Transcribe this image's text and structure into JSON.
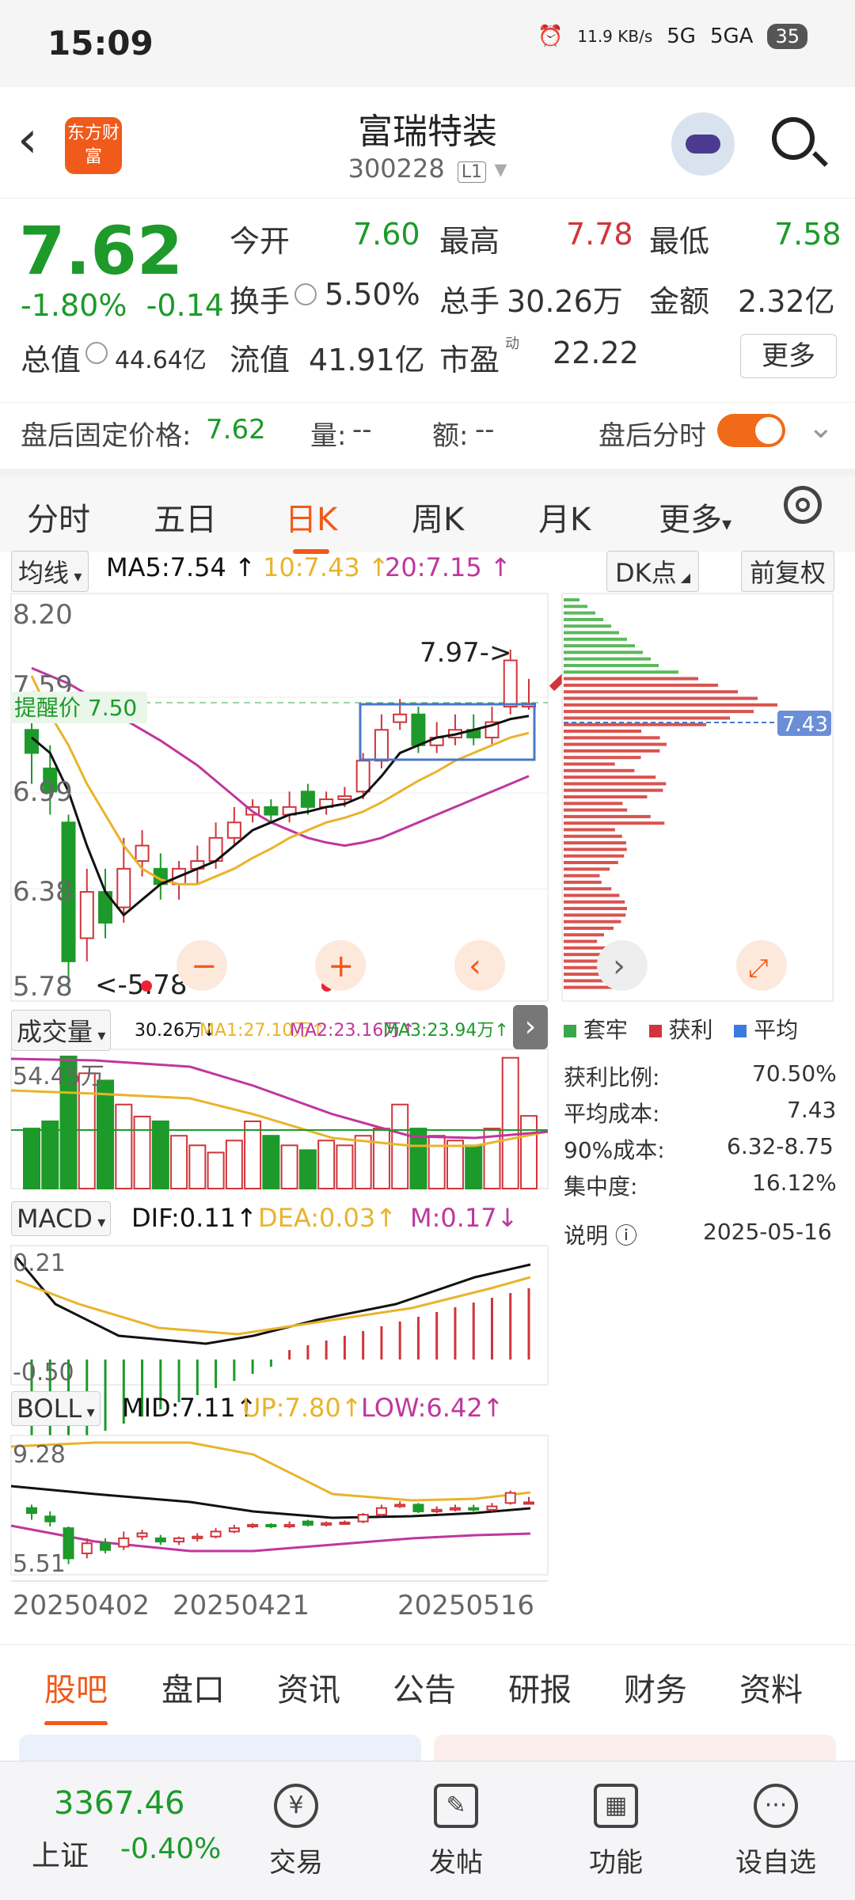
{
  "status_bar": {
    "time": "15:09",
    "net_speed": "11.9 KB/s",
    "signal1": "5G",
    "signal2": "5GA",
    "battery": "35"
  },
  "header": {
    "back_icon": "chevron-left-icon",
    "logo_text": "东方财富",
    "stock_name": "富瑞特装",
    "stock_code": "300228",
    "level": "L1"
  },
  "quote": {
    "price": "7.62",
    "change_pct": "-1.80%",
    "change": "-0.14",
    "open_label": "今开",
    "open": "7.60",
    "high_label": "最高",
    "high": "7.78",
    "low_label": "最低",
    "low": "7.58",
    "turnover_label": "换手",
    "turnover": "5.50%",
    "volume_label": "总手",
    "volume": "30.26万",
    "amount_label": "金额",
    "amount": "2.32亿",
    "mcap_label": "总值",
    "mcap": "44.64亿",
    "float_label": "流值",
    "float": "41.91亿",
    "pe_label": "市盈",
    "pe_sup": "动",
    "pe": "22.22",
    "more_label": "更多"
  },
  "after_hours": {
    "label": "盘后固定价格:",
    "price": "7.62",
    "vol_label": "量:",
    "vol": "--",
    "amt_label": "额:",
    "amt": "--",
    "timeshare_label": "盘后分时"
  },
  "kline_tabs": [
    "分时",
    "五日",
    "日K",
    "周K",
    "月K",
    "更多"
  ],
  "active_tab": "日K",
  "ma_row": {
    "selector": "均线",
    "ma5": "MA5:7.54",
    "ma10": "10:7.43",
    "ma20": "20:7.15",
    "dk_label": "DK点",
    "adjust_label": "前复权"
  },
  "main_chart": {
    "y_max": "8.20",
    "y_2": "7.59",
    "y_3": "6.99",
    "y_4": "6.38",
    "y_min": "5.78",
    "alert_label": "提醒价 7.50",
    "high_annot": "7.97->",
    "low_annot": "<-5.78"
  },
  "chip_chart": {
    "avg_price": "7.43",
    "legend_trapped": "套牢",
    "legend_profit": "获利",
    "legend_avg": "平均",
    "profit_ratio_label": "获利比例:",
    "profit_ratio": "70.50%",
    "avg_cost_label": "平均成本:",
    "avg_cost": "7.43",
    "cost90_label": "90%成本:",
    "cost90": "6.32-8.75",
    "concentration_label": "集中度:",
    "concentration": "16.12%",
    "note_label": "说明",
    "date": "2025-05-16"
  },
  "volume_row": {
    "selector": "成交量",
    "vol": "30.26万",
    "ma1": "MA1:27.10万",
    "ma2": "MA2:23.16万",
    "ma3": "MA3:23.94万",
    "y_max": "54.45万"
  },
  "macd_row": {
    "selector": "MACD",
    "dif": "DIF:0.11",
    "dea": "DEA:0.03",
    "m": "M:0.17",
    "y_max": "0.21",
    "y_min": "-0.50"
  },
  "boll_row": {
    "selector": "BOLL",
    "mid": "MID:7.11",
    "up": "UP:7.80",
    "low": "LOW:6.42",
    "y_max": "9.28",
    "y_min": "5.51"
  },
  "x_axis": [
    "20250402",
    "20250421",
    "20250516"
  ],
  "news_tabs": [
    "股吧",
    "盘口",
    "资讯",
    "公告",
    "研报",
    "财务",
    "资料"
  ],
  "bottom_nav": {
    "index_value": "3367.46",
    "index_name": "上证",
    "index_change": "-0.40%",
    "items": [
      {
        "label": "交易",
        "icon": "yen-swap-icon"
      },
      {
        "label": "发帖",
        "icon": "edit-icon"
      },
      {
        "label": "功能",
        "icon": "grid-icon"
      },
      {
        "label": "设自选",
        "icon": "more-icon"
      }
    ]
  },
  "colors": {
    "up": "#d0353b",
    "down": "#1d9a2a",
    "accent": "#f05a1a",
    "ma5": "#111111",
    "ma10": "#e9b42a",
    "ma20": "#c0369e"
  },
  "chart_data": {
    "type": "candlestick",
    "x": [
      "20250402",
      "20250421",
      "20250516"
    ],
    "ylim": [
      5.78,
      8.2
    ],
    "candles": [
      {
        "o": 7.45,
        "c": 7.3,
        "h": 7.55,
        "l": 7.1
      },
      {
        "o": 7.2,
        "c": 7.05,
        "h": 7.35,
        "l": 6.9
      },
      {
        "o": 6.85,
        "c": 5.95,
        "h": 6.9,
        "l": 5.78
      },
      {
        "o": 6.1,
        "c": 6.4,
        "h": 6.55,
        "l": 5.95
      },
      {
        "o": 6.4,
        "c": 6.2,
        "h": 6.55,
        "l": 6.1
      },
      {
        "o": 6.3,
        "c": 6.55,
        "h": 6.75,
        "l": 6.2
      },
      {
        "o": 6.6,
        "c": 6.7,
        "h": 6.8,
        "l": 6.5
      },
      {
        "o": 6.55,
        "c": 6.45,
        "h": 6.65,
        "l": 6.35
      },
      {
        "o": 6.45,
        "c": 6.55,
        "h": 6.6,
        "l": 6.35
      },
      {
        "o": 6.55,
        "c": 6.6,
        "h": 6.7,
        "l": 6.45
      },
      {
        "o": 6.6,
        "c": 6.75,
        "h": 6.85,
        "l": 6.55
      },
      {
        "o": 6.75,
        "c": 6.85,
        "h": 6.95,
        "l": 6.7
      },
      {
        "o": 6.9,
        "c": 6.95,
        "h": 7.0,
        "l": 6.85
      },
      {
        "o": 6.95,
        "c": 6.9,
        "h": 7.0,
        "l": 6.85
      },
      {
        "o": 6.9,
        "c": 6.95,
        "h": 7.05,
        "l": 6.85
      },
      {
        "o": 7.05,
        "c": 6.95,
        "h": 7.1,
        "l": 6.9
      },
      {
        "o": 6.95,
        "c": 7.0,
        "h": 7.05,
        "l": 6.9
      },
      {
        "o": 7.0,
        "c": 7.02,
        "h": 7.08,
        "l": 6.95
      },
      {
        "o": 7.05,
        "c": 7.25,
        "h": 7.3,
        "l": 7.0
      },
      {
        "o": 7.25,
        "c": 7.45,
        "h": 7.55,
        "l": 7.2
      },
      {
        "o": 7.5,
        "c": 7.55,
        "h": 7.65,
        "l": 7.45
      },
      {
        "o": 7.55,
        "c": 7.35,
        "h": 7.6,
        "l": 7.3
      },
      {
        "o": 7.35,
        "c": 7.4,
        "h": 7.5,
        "l": 7.3
      },
      {
        "o": 7.4,
        "c": 7.45,
        "h": 7.55,
        "l": 7.35
      },
      {
        "o": 7.45,
        "c": 7.4,
        "h": 7.55,
        "l": 7.35
      },
      {
        "o": 7.4,
        "c": 7.5,
        "h": 7.6,
        "l": 7.35
      },
      {
        "o": 7.6,
        "c": 7.9,
        "h": 7.97,
        "l": 7.55
      },
      {
        "o": 7.6,
        "c": 7.62,
        "h": 7.78,
        "l": 7.58
      }
    ],
    "ma5": [
      7.4,
      7.3,
      7.05,
      6.7,
      6.4,
      6.25,
      6.35,
      6.45,
      6.5,
      6.55,
      6.6,
      6.7,
      6.8,
      6.85,
      6.9,
      6.92,
      6.95,
      6.97,
      7.02,
      7.15,
      7.3,
      7.35,
      7.4,
      7.42,
      7.45,
      7.48,
      7.52,
      7.54
    ],
    "ma10": [
      7.8,
      7.55,
      7.35,
      7.1,
      6.9,
      6.7,
      6.55,
      6.48,
      6.45,
      6.45,
      6.5,
      6.55,
      6.62,
      6.68,
      6.75,
      6.8,
      6.85,
      6.88,
      6.92,
      6.98,
      7.05,
      7.12,
      7.18,
      7.25,
      7.3,
      7.35,
      7.4,
      7.43
    ],
    "ma20": [
      7.85,
      7.8,
      7.75,
      7.68,
      7.6,
      7.52,
      7.45,
      7.38,
      7.3,
      7.22,
      7.12,
      7.02,
      6.92,
      6.85,
      6.8,
      6.75,
      6.72,
      6.7,
      6.72,
      6.75,
      6.8,
      6.85,
      6.9,
      6.95,
      7.0,
      7.05,
      7.1,
      7.15
    ],
    "volume": [
      25,
      28,
      55,
      48,
      45,
      35,
      30,
      28,
      22,
      18,
      15,
      20,
      28,
      22,
      18,
      16,
      20,
      18,
      22,
      25,
      35,
      25,
      22,
      20,
      18,
      25,
      54.45,
      30.26
    ]
  }
}
